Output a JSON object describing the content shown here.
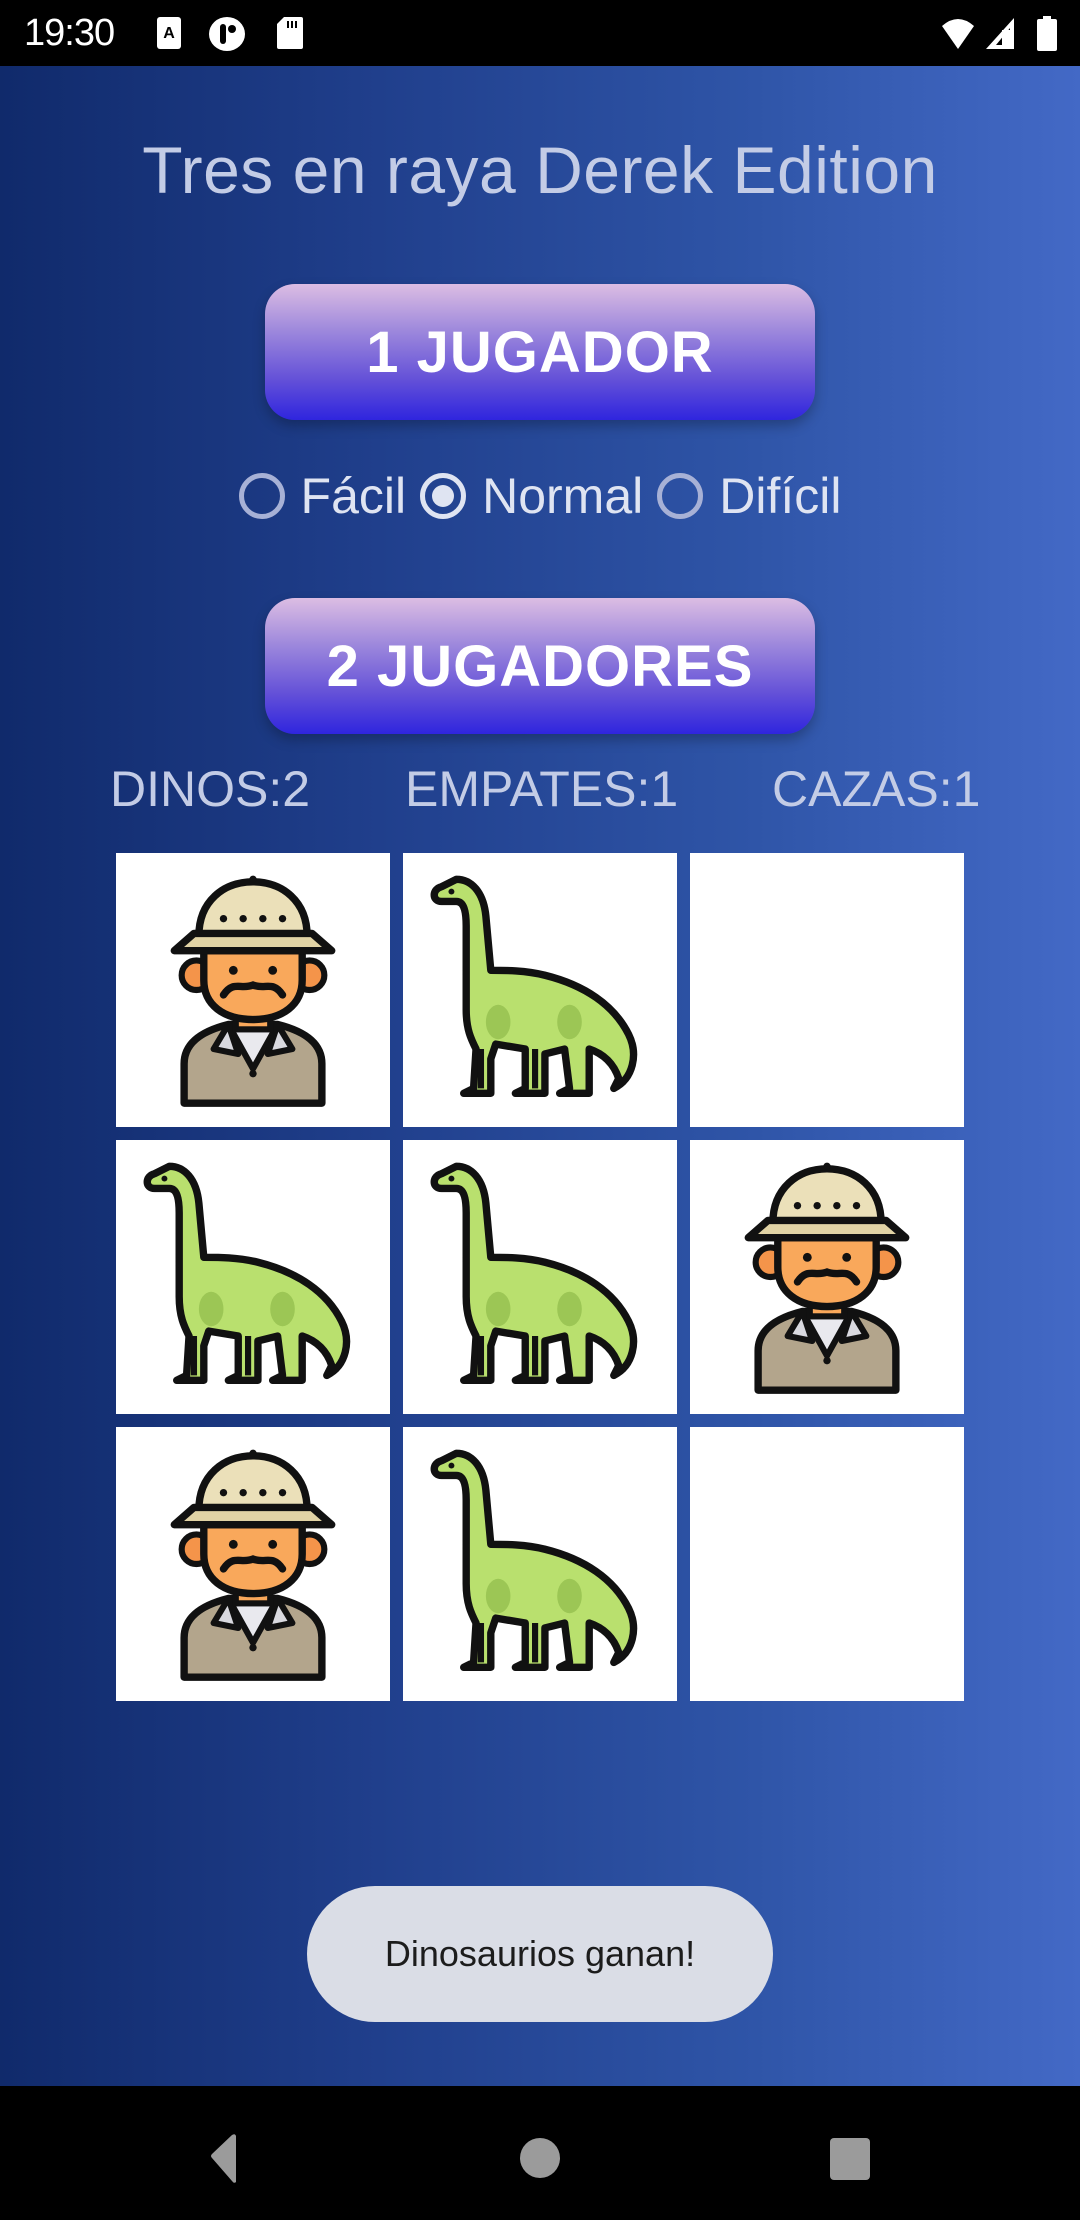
{
  "status_bar": {
    "time": "19:30",
    "left_icons": [
      "text-a-notification-icon",
      "o-p-app-icon",
      "sd-card-icon"
    ],
    "right_icons": [
      "wifi-icon",
      "signal-icon",
      "battery-icon"
    ]
  },
  "app": {
    "title": "Tres en raya Derek Edition",
    "buttons": {
      "one_player": "1 JUGADOR",
      "two_players": "2 JUGADORES"
    },
    "difficulty": {
      "options": [
        {
          "label": "Fácil",
          "checked": false
        },
        {
          "label": "Normal",
          "checked": true
        },
        {
          "label": "Difícil",
          "checked": false
        }
      ],
      "selected": "Normal"
    },
    "scores": {
      "dinos": "DINOS:2",
      "draws": "EMPATES:1",
      "hunters": "CAZAS:1"
    },
    "board": {
      "cells": [
        "hunter",
        "dino",
        "empty",
        "dino",
        "dino",
        "hunter",
        "hunter",
        "dino",
        "empty"
      ],
      "piece_icons": {
        "dino": "brachiosaurus-icon",
        "hunter": "safari-explorer-icon"
      }
    },
    "toast": "Dinosaurios ganan!"
  },
  "nav_bar": {
    "buttons": [
      "back-icon",
      "home-icon",
      "recents-icon"
    ]
  },
  "colors": {
    "button_top": "#dcbde3",
    "button_bottom": "#2f25de",
    "background_left": "#102a6b",
    "background_right": "#4369c6",
    "dino_green": "#b9e06e",
    "hat_beige": "#ebe0b9",
    "face_orange": "#f9a85b"
  }
}
